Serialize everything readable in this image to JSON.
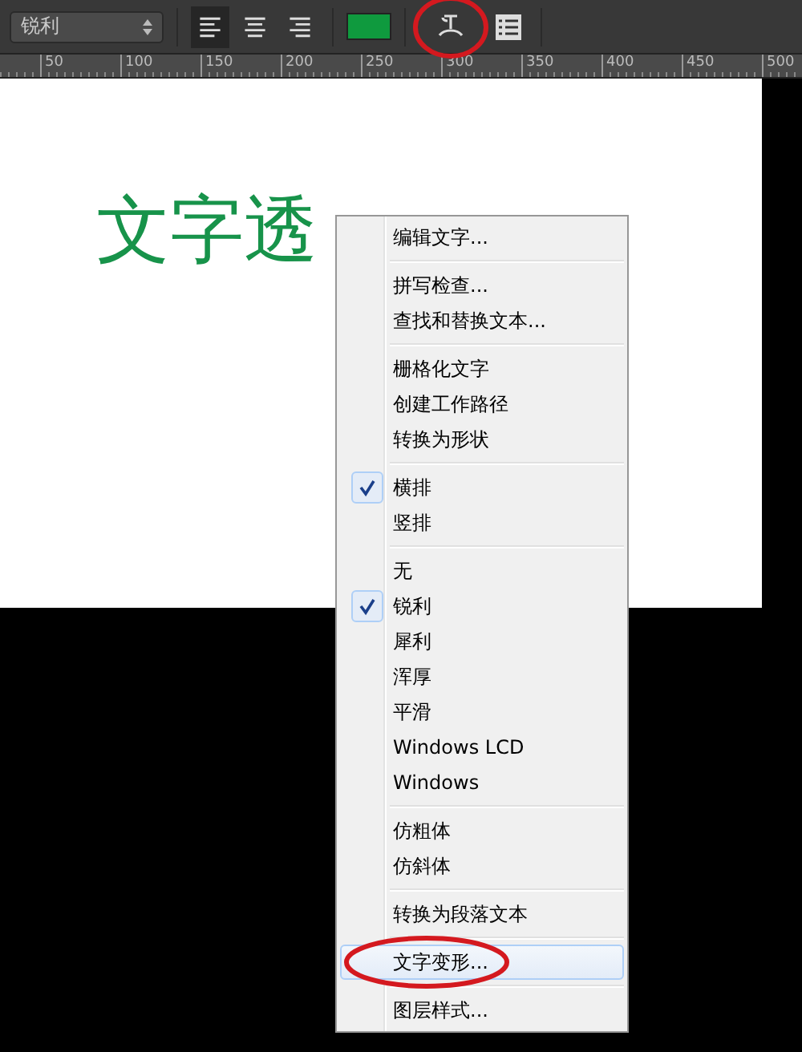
{
  "toolbar": {
    "antialias": {
      "value": "锐利"
    },
    "align": [
      {
        "kind": "left",
        "selected": true
      },
      {
        "kind": "center",
        "selected": false
      },
      {
        "kind": "right",
        "selected": false
      }
    ],
    "text_color": {
      "color": "#0f9a3e"
    },
    "warp_button": {
      "highlighted": true
    }
  },
  "ruler": {
    "labels": [
      "50",
      "100",
      "150",
      "200",
      "250",
      "300",
      "350",
      "400",
      "450",
      "500"
    ]
  },
  "canvas": {
    "text": "文字透"
  },
  "context_menu": {
    "groups": [
      [
        {
          "label": "编辑文字...",
          "checked": false,
          "selected": false
        }
      ],
      [
        {
          "label": "拼写检查...",
          "checked": false,
          "selected": false
        },
        {
          "label": "查找和替换文本...",
          "checked": false,
          "selected": false
        }
      ],
      [
        {
          "label": "栅格化文字",
          "checked": false,
          "selected": false
        },
        {
          "label": "创建工作路径",
          "checked": false,
          "selected": false
        },
        {
          "label": "转换为形状",
          "checked": false,
          "selected": false
        }
      ],
      [
        {
          "label": "横排",
          "checked": true,
          "selected": false
        },
        {
          "label": "竖排",
          "checked": false,
          "selected": false
        }
      ],
      [
        {
          "label": "无",
          "checked": false,
          "selected": false
        },
        {
          "label": "锐利",
          "checked": true,
          "selected": false
        },
        {
          "label": "犀利",
          "checked": false,
          "selected": false
        },
        {
          "label": "浑厚",
          "checked": false,
          "selected": false
        },
        {
          "label": "平滑",
          "checked": false,
          "selected": false
        },
        {
          "label": "Windows LCD",
          "checked": false,
          "selected": false
        },
        {
          "label": "Windows",
          "checked": false,
          "selected": false
        }
      ],
      [
        {
          "label": "仿粗体",
          "checked": false,
          "selected": false
        },
        {
          "label": "仿斜体",
          "checked": false,
          "selected": false
        }
      ],
      [
        {
          "label": "转换为段落文本",
          "checked": false,
          "selected": false
        }
      ],
      [
        {
          "label": "文字变形...",
          "checked": false,
          "selected": true
        }
      ],
      [
        {
          "label": "图层样式...",
          "checked": false,
          "selected": false
        }
      ]
    ]
  }
}
